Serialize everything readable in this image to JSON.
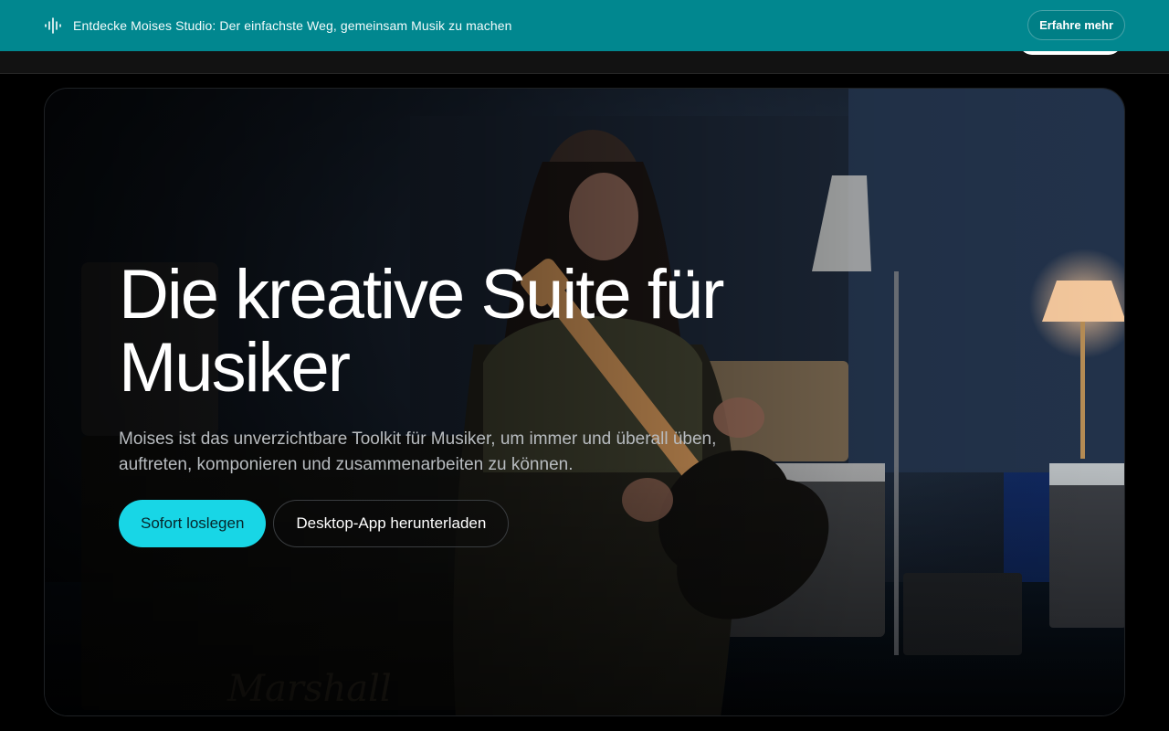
{
  "banner": {
    "icon": "waveform-icon",
    "text": "Entdecke Moises Studio: Der einfachste Weg, gemeinsam Musik zu machen",
    "cta_label": "Erfahre mehr",
    "background": "#01878f"
  },
  "hero": {
    "title_line1": "Die kreative Suite für",
    "title_line2": "Musiker",
    "subtitle_line1": "Moises ist das unverzichtbare Toolkit für Musiker, um immer und überall üben,",
    "subtitle_line2": "auftreten, komponieren und zusammenarbeiten zu können.",
    "primary_button": "Sofort loslegen",
    "secondary_button": "Desktop-App herunterladen",
    "accent": "#18d6e6",
    "background_image": "guitarist-in-studio"
  }
}
